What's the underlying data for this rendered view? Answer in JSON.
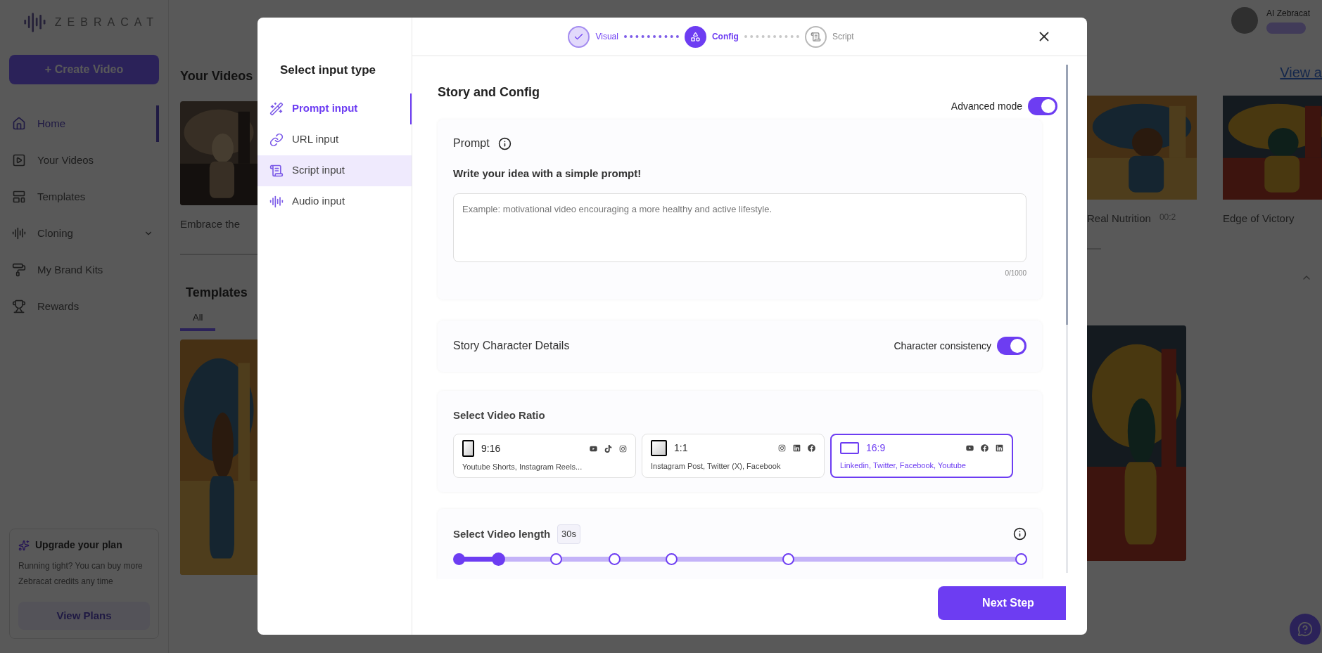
{
  "app": {
    "logo": "ZEBRACAT",
    "create_button": "+ Create Video",
    "nav": [
      {
        "label": "Home",
        "kind": "home",
        "selected": true
      },
      {
        "label": "Your Videos",
        "kind": "video",
        "selected": false
      },
      {
        "label": "Templates",
        "kind": "template",
        "selected": false
      },
      {
        "label": "Cloning",
        "kind": "wave",
        "selected": false,
        "expandable": true
      },
      {
        "label": "My Brand Kits",
        "kind": "brush",
        "selected": false
      },
      {
        "label": "Rewards",
        "kind": "trophy",
        "selected": false
      }
    ],
    "upgrade": {
      "title": "Upgrade your plan",
      "text": "Running tight? You can buy more Zebracat credits any time",
      "button": "View Plans"
    },
    "videos_heading": "Your Videos",
    "view_all_link": "View a",
    "videos_left": [
      {
        "title": "Embrace the"
      }
    ],
    "videos_right": [
      {
        "title": "Real Nutrition",
        "duration": "00:2"
      },
      {
        "title": "Edge of Victory"
      }
    ],
    "templates_heading": "Templates",
    "template_tabs": [
      {
        "label": "All",
        "selected": true
      }
    ],
    "user": {
      "name": "AI Zebracat"
    }
  },
  "modal": {
    "steps": [
      {
        "label": "Visual",
        "completed": true,
        "selected": false
      },
      {
        "label": "Config",
        "completed": false,
        "selected": true
      },
      {
        "label": "Script",
        "completed": false,
        "selected": false
      }
    ],
    "sidebar_title": "Select input type",
    "input_types": [
      {
        "label": "Prompt input",
        "kind": "wand",
        "selected": true,
        "hovered": false
      },
      {
        "label": "URL input",
        "kind": "link",
        "selected": false,
        "hovered": false
      },
      {
        "label": "Script input",
        "kind": "scroll",
        "selected": false,
        "hovered": true
      },
      {
        "label": "Audio input",
        "kind": "audio",
        "selected": false,
        "hovered": false
      }
    ],
    "title": "Story and Config",
    "advanced_mode": {
      "label": "Advanced mode",
      "on": true
    },
    "prompt": {
      "label": "Prompt",
      "heading": "Write your idea with a simple prompt!",
      "placeholder": "Example: motivational video encouraging a more healthy and active lifestyle.",
      "counter": "0/1000"
    },
    "character": {
      "label": "Story Character Details",
      "toggle_label": "Character consistency",
      "on": true
    },
    "ratio": {
      "label": "Select Video Ratio",
      "options": [
        {
          "ratio": "9:16",
          "kind": "portrait",
          "platforms": "Youtube Shorts, Instagram Reels...",
          "icons": [
            {
              "kind": "youtube"
            },
            {
              "kind": "tiktok"
            },
            {
              "kind": "instagram"
            }
          ],
          "selected": false
        },
        {
          "ratio": "1:1",
          "kind": "square",
          "platforms": "Instagram Post, Twitter (X), Facebook",
          "icons": [
            {
              "kind": "instagram"
            },
            {
              "kind": "linkedin"
            },
            {
              "kind": "facebook"
            }
          ],
          "selected": false
        },
        {
          "ratio": "16:9",
          "kind": "landscape",
          "platforms": "Linkedin, Twitter, Facebook, Youtube",
          "icons": [
            {
              "kind": "youtube"
            },
            {
              "kind": "facebook"
            },
            {
              "kind": "linkedin"
            }
          ],
          "selected": true
        }
      ]
    },
    "length": {
      "label": "Select Video length",
      "value": "30s",
      "level": 0.07
    },
    "next_button": "Next Step"
  }
}
